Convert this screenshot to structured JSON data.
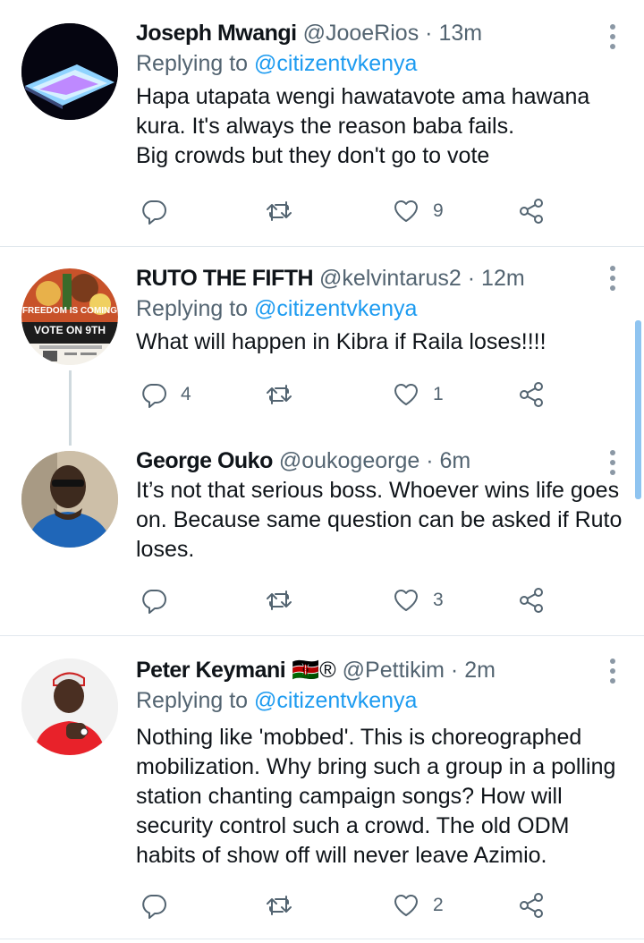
{
  "tweets": [
    {
      "name": "Joseph Mwangi",
      "handle": "@JooeRios",
      "dot": "·",
      "time": "13m",
      "replying_prefix": "Replying to ",
      "replying_to": "@citizentvkenya",
      "text_lines": [
        "Hapa utapata wengi hawatavote ama hawana",
        "kura. It's always the reason baba fails.",
        "Big crowds but they don't go to vote"
      ],
      "replies": "",
      "retweets": "",
      "likes": "9"
    },
    {
      "name": "RUTO THE FIFTH",
      "handle": "@kelvintarus2",
      "dot": "·",
      "time": "12m",
      "replying_prefix": "Replying to ",
      "replying_to": "@citizentvkenya",
      "text_lines": [
        "What will happen in Kibra if Raila loses!!!!"
      ],
      "replies": "4",
      "retweets": "",
      "likes": "1",
      "avatar_text": [
        "FREEDOM IS COMING",
        "VOTE ON 9TH"
      ]
    },
    {
      "name": "George Ouko",
      "handle": "@oukogeorge",
      "dot": "·",
      "time": "6m",
      "text_lines": [
        "It’s not that serious boss. Whoever wins life goes",
        "on. Because same question can be asked if Ruto",
        "loses."
      ],
      "replies": "",
      "retweets": "",
      "likes": "3"
    },
    {
      "name": "Peter Keymani",
      "name_suffix": "🇰🇪®",
      "handle": "@Pettikim",
      "dot": "·",
      "time": "2m",
      "replying_prefix": "Replying to ",
      "replying_to": "@citizentvkenya",
      "text_lines": [
        "Nothing like 'mobbed'. This is choreographed",
        "mobilization. Why bring such a group in a polling",
        "station chanting campaign songs? How will",
        "security control such a crowd. The old ODM",
        "habits of show off will never leave Azimio."
      ],
      "replies": "",
      "retweets": "",
      "likes": "2"
    }
  ],
  "icons": {
    "reply": "reply-icon",
    "retweet": "retweet-icon",
    "like": "heart-icon",
    "share": "share-icon",
    "more": "more-vertical-icon"
  },
  "colors": {
    "link": "#1d9bf0",
    "muted": "#536471",
    "divider": "#e1e8ed"
  }
}
